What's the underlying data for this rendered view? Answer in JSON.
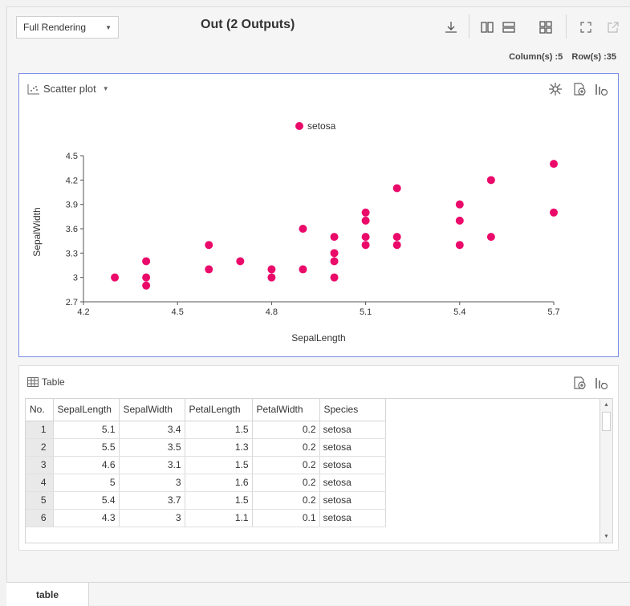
{
  "toolbar": {
    "rendering_mode": "Full Rendering",
    "title": "Out (2 Outputs)",
    "icons": [
      "download-icon",
      "columns-layout-icon",
      "rows-layout-icon",
      "grid-layout-icon",
      "fit-screen-icon",
      "open-external-icon"
    ]
  },
  "summary": {
    "columns": "Column(s) :5",
    "rows": "Row(s) :35"
  },
  "scatter_panel": {
    "label": "Scatter plot",
    "icons": [
      "chart-type-icon",
      "settings-icon",
      "add-chart-icon",
      "chart-options-icon"
    ]
  },
  "chart_data": {
    "type": "scatter",
    "xlabel": "SepalLength",
    "ylabel": "SepalWidth",
    "xlim": [
      4.2,
      5.7
    ],
    "ylim": [
      2.7,
      4.5
    ],
    "xticks": [
      "4.2",
      "4.5",
      "4.8",
      "5.1",
      "5.4",
      "5.7"
    ],
    "yticks": [
      "2.7",
      "3",
      "3.3",
      "3.6",
      "3.9",
      "4.2",
      "4.5"
    ],
    "legend": "top",
    "color": "#ea0a6a",
    "series": [
      {
        "name": "setosa",
        "points": [
          [
            4.3,
            3.0
          ],
          [
            4.4,
            2.9
          ],
          [
            4.4,
            3.0
          ],
          [
            4.4,
            3.2
          ],
          [
            4.6,
            3.1
          ],
          [
            4.6,
            3.4
          ],
          [
            4.7,
            3.2
          ],
          [
            4.8,
            3.0
          ],
          [
            4.8,
            3.1
          ],
          [
            4.9,
            3.1
          ],
          [
            4.9,
            3.6
          ],
          [
            5.0,
            3.0
          ],
          [
            5.0,
            3.2
          ],
          [
            5.0,
            3.3
          ],
          [
            5.0,
            3.5
          ],
          [
            5.1,
            3.4
          ],
          [
            5.1,
            3.5
          ],
          [
            5.1,
            3.7
          ],
          [
            5.1,
            3.8
          ],
          [
            5.2,
            3.4
          ],
          [
            5.2,
            3.5
          ],
          [
            5.2,
            4.1
          ],
          [
            5.4,
            3.4
          ],
          [
            5.4,
            3.7
          ],
          [
            5.4,
            3.9
          ],
          [
            5.5,
            3.5
          ],
          [
            5.5,
            4.2
          ],
          [
            5.7,
            3.8
          ],
          [
            5.7,
            4.4
          ]
        ]
      }
    ]
  },
  "table_panel": {
    "label": "Table",
    "icons": [
      "table-icon",
      "add-chart-icon",
      "chart-options-icon"
    ],
    "columns": [
      "No.",
      "SepalLength",
      "SepalWidth",
      "PetalLength",
      "PetalWidth",
      "Species"
    ],
    "rows": [
      [
        "1",
        "5.1",
        "3.4",
        "1.5",
        "0.2",
        "setosa"
      ],
      [
        "2",
        "5.5",
        "3.5",
        "1.3",
        "0.2",
        "setosa"
      ],
      [
        "3",
        "4.6",
        "3.1",
        "1.5",
        "0.2",
        "setosa"
      ],
      [
        "4",
        "5",
        "3",
        "1.6",
        "0.2",
        "setosa"
      ],
      [
        "5",
        "5.4",
        "3.7",
        "1.5",
        "0.2",
        "setosa"
      ],
      [
        "6",
        "4.3",
        "3",
        "1.1",
        "0.1",
        "setosa"
      ]
    ]
  },
  "tabs": [
    {
      "label": "table"
    }
  ]
}
